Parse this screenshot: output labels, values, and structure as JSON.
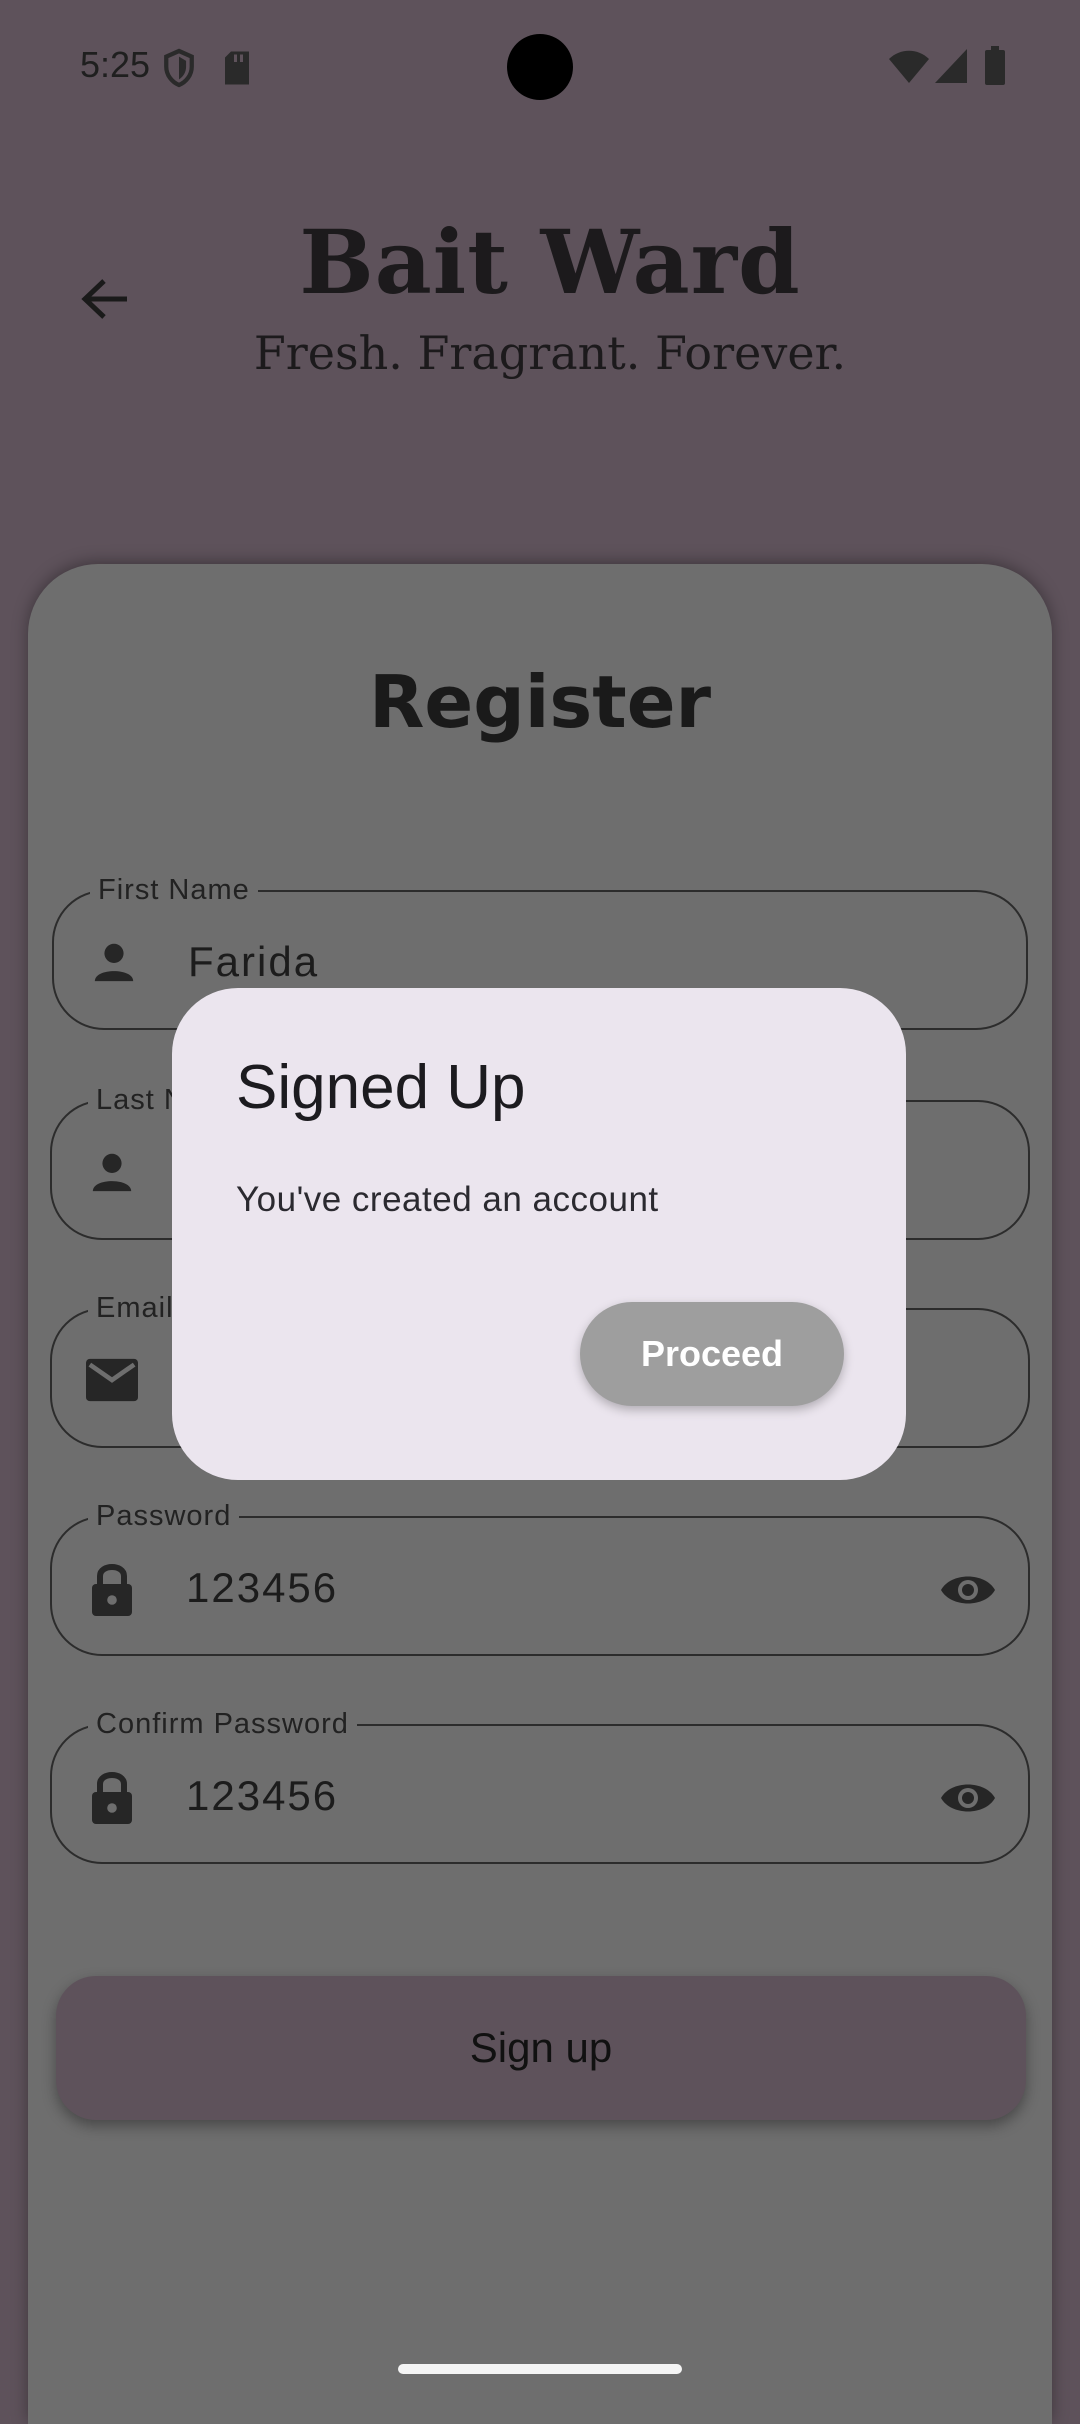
{
  "status_bar": {
    "time": "5:25",
    "left_icons": [
      "shield-icon",
      "sd-card-icon"
    ],
    "right_icons": [
      "wifi-icon",
      "signal-icon",
      "battery-icon"
    ]
  },
  "header": {
    "back_icon": "arrow-back-icon",
    "title": "Bait Ward",
    "tagline": "Fresh. Fragrant. Forever."
  },
  "form": {
    "title": "Register",
    "fields": [
      {
        "label": "First Name",
        "value": "Farida",
        "icon": "person-icon"
      },
      {
        "label": "Last Name",
        "value": "",
        "icon": "person-icon"
      },
      {
        "label": "Email",
        "value": "",
        "icon": "mail-icon"
      },
      {
        "label": "Password",
        "value": "123456",
        "icon": "lock-icon",
        "trailing_icon": "eye-icon"
      },
      {
        "label": "Confirm Password",
        "value": "123456",
        "icon": "lock-icon",
        "trailing_icon": "eye-icon"
      }
    ],
    "submit_label": "Sign up"
  },
  "dialog": {
    "title": "Signed Up",
    "message": "You've created an account",
    "action_label": "Proceed"
  },
  "colors": {
    "scrim_background": "#5e525b",
    "card_background": "#6e6e6e",
    "dialog_background": "#ebe5ee",
    "proceed_button": "#9e9e9e"
  }
}
